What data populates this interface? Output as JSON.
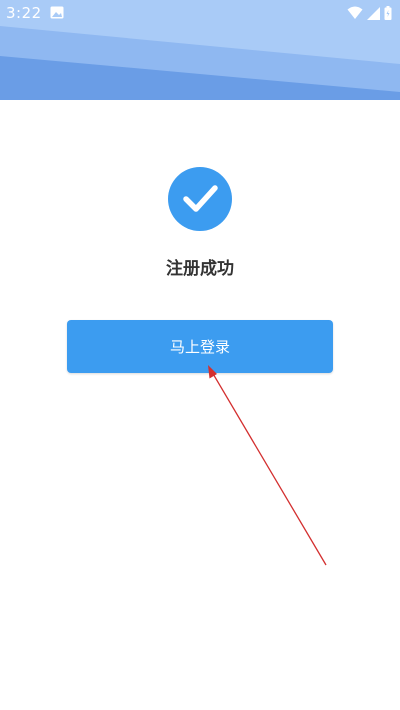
{
  "status_bar": {
    "time": "3:22",
    "icons": [
      "image-notification-icon",
      "wifi-icon",
      "cellular-signal-icon",
      "battery-icon"
    ]
  },
  "header": {
    "colors": [
      "#a9cbf7",
      "#8fb8f1",
      "#6a9de6"
    ]
  },
  "main": {
    "success_icon": "check-circle-icon",
    "success_icon_color": "#3c9cf0",
    "success_text": "注册成功",
    "login_button_label": "马上登录",
    "button_color": "#3c9cf0"
  },
  "annotation": {
    "arrow_color": "#d32f2f",
    "icon": "red-arrow-pointer"
  }
}
